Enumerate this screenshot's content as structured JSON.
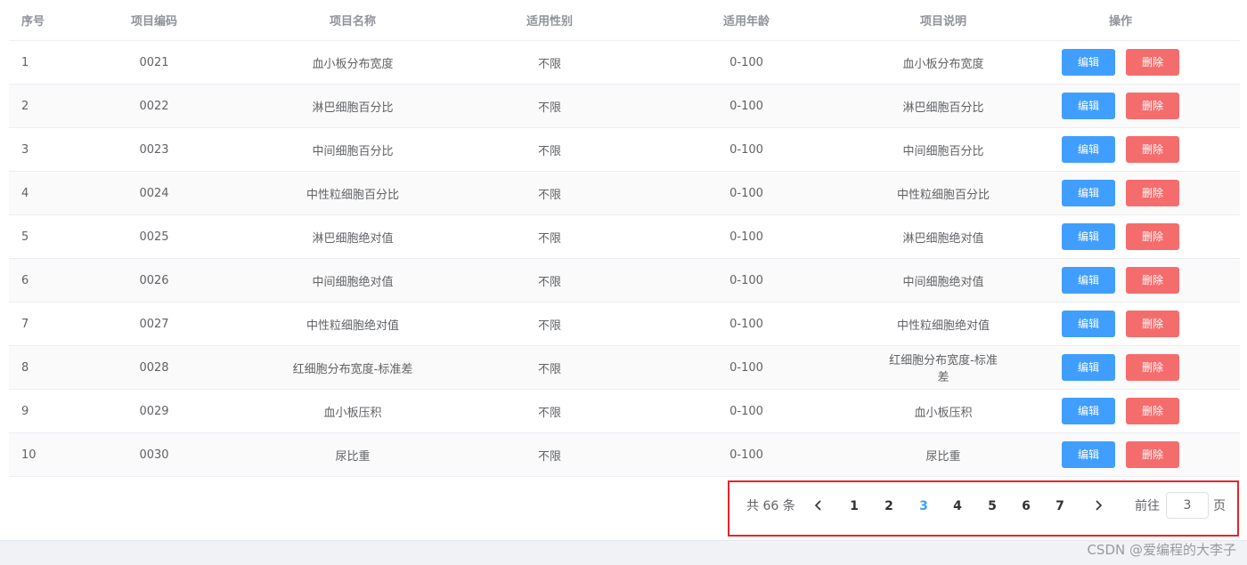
{
  "table": {
    "headers": {
      "index": "序号",
      "code": "项目编码",
      "name": "项目名称",
      "gender": "适用性别",
      "age": "适用年龄",
      "desc": "项目说明",
      "actions": "操作"
    },
    "edit_label": "编辑",
    "delete_label": "删除",
    "rows": [
      {
        "index": "1",
        "code": "0021",
        "name": "血小板分布宽度",
        "gender": "不限",
        "age": "0-100",
        "desc": "血小板分布宽度"
      },
      {
        "index": "2",
        "code": "0022",
        "name": "淋巴细胞百分比",
        "gender": "不限",
        "age": "0-100",
        "desc": "淋巴细胞百分比"
      },
      {
        "index": "3",
        "code": "0023",
        "name": "中间细胞百分比",
        "gender": "不限",
        "age": "0-100",
        "desc": "中间细胞百分比"
      },
      {
        "index": "4",
        "code": "0024",
        "name": "中性粒细胞百分比",
        "gender": "不限",
        "age": "0-100",
        "desc": "中性粒细胞百分比"
      },
      {
        "index": "5",
        "code": "0025",
        "name": "淋巴细胞绝对值",
        "gender": "不限",
        "age": "0-100",
        "desc": "淋巴细胞绝对值"
      },
      {
        "index": "6",
        "code": "0026",
        "name": "中间细胞绝对值",
        "gender": "不限",
        "age": "0-100",
        "desc": "中间细胞绝对值"
      },
      {
        "index": "7",
        "code": "0027",
        "name": "中性粒细胞绝对值",
        "gender": "不限",
        "age": "0-100",
        "desc": "中性粒细胞绝对值"
      },
      {
        "index": "8",
        "code": "0028",
        "name": "红细胞分布宽度-标准差",
        "gender": "不限",
        "age": "0-100",
        "desc": "红细胞分布宽度-标准差"
      },
      {
        "index": "9",
        "code": "0029",
        "name": "血小板压积",
        "gender": "不限",
        "age": "0-100",
        "desc": "血小板压积"
      },
      {
        "index": "10",
        "code": "0030",
        "name": "尿比重",
        "gender": "不限",
        "age": "0-100",
        "desc": "尿比重"
      }
    ]
  },
  "pagination": {
    "total_text": "共 66 条",
    "prev_icon": "chevron-left-icon",
    "next_icon": "chevron-right-icon",
    "pages": [
      "1",
      "2",
      "3",
      "4",
      "5",
      "6",
      "7"
    ],
    "current_page": "3",
    "goto_label": "前往",
    "goto_value": "3",
    "goto_suffix": "页"
  },
  "watermark": "CSDN @爱编程的大李子",
  "colors": {
    "primary": "#409eff",
    "danger": "#f56c6c",
    "highlight_border": "#e3242b"
  }
}
